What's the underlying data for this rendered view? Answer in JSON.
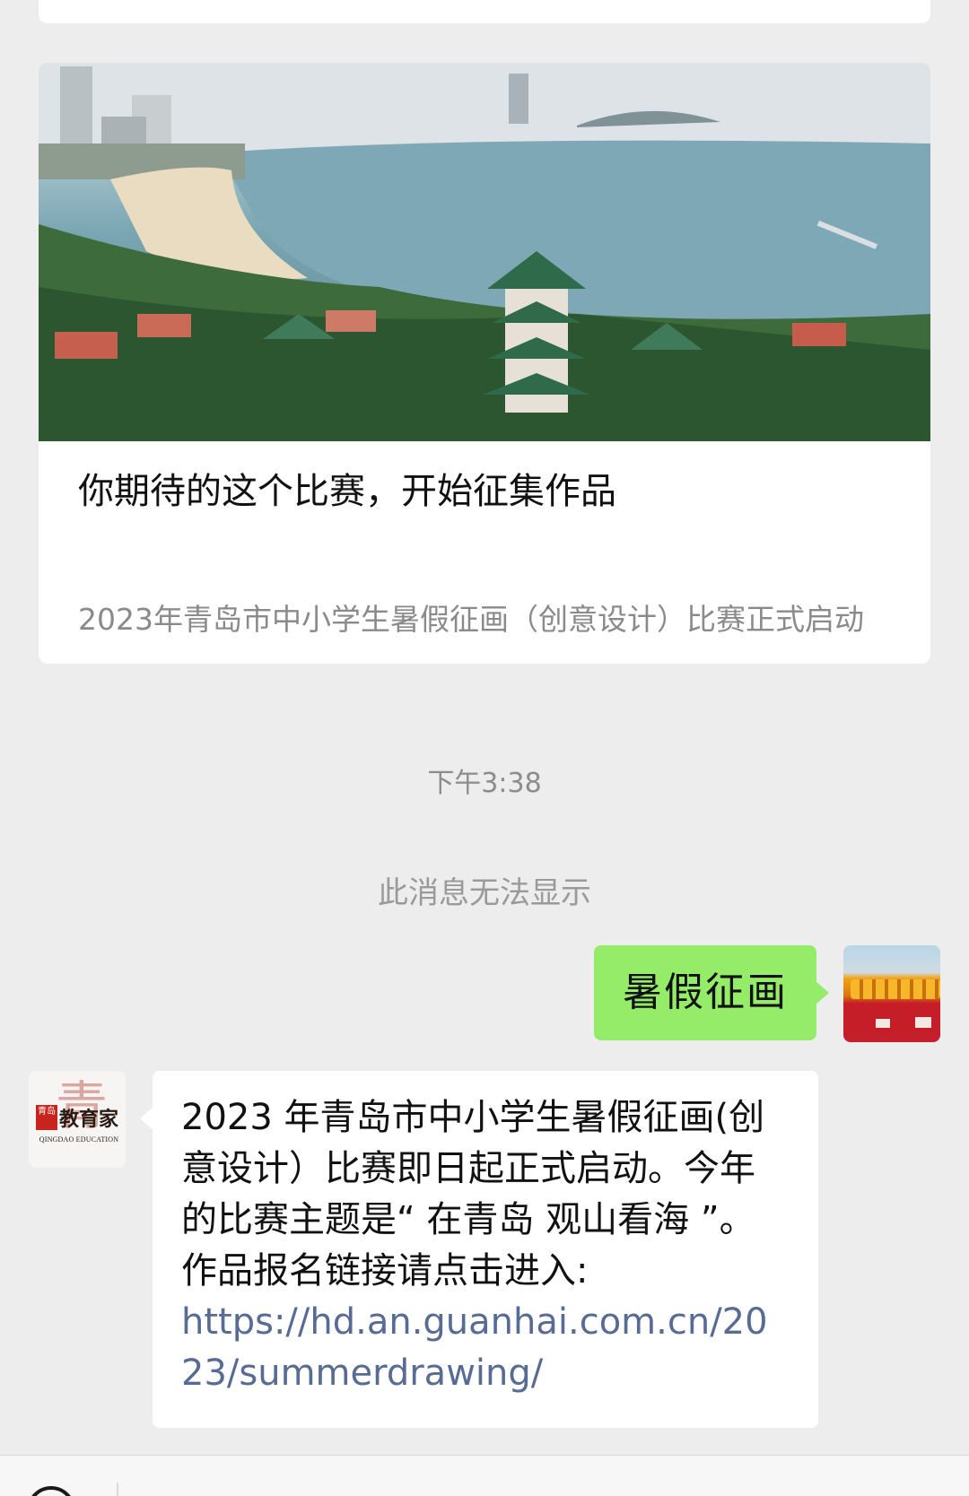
{
  "article": {
    "title": "你期待的这个比赛，开始征集作品",
    "description": "2023年青岛市中小学生暑假征画（创意设计）比赛正式启动",
    "cover_icon": "coastline-pagoda-photo"
  },
  "chat": {
    "time_label": "下午3:38",
    "system_notice": "此消息无法显示",
    "outgoing_message": "暑假征画",
    "incoming_message": {
      "sender_brand": "教育家",
      "sender_brand_seal": "青岛",
      "sender_brand_char": "青",
      "sender_brand_en": "QINGDAO EDUCATION",
      "text": "2023 年青岛市中小学生暑假征画(创意设计）比赛即日起正式启动。今年的比赛主题是“ 在青岛 观山看海 ”。作品报名链接请点击进入:",
      "link": "https://hd.an.guanhai.com.cn/2023/summerdrawing/"
    }
  },
  "colors": {
    "chat_background": "#ededed",
    "outgoing_bubble": "#95ec69",
    "incoming_bubble": "#ffffff",
    "link": "#576b95"
  }
}
